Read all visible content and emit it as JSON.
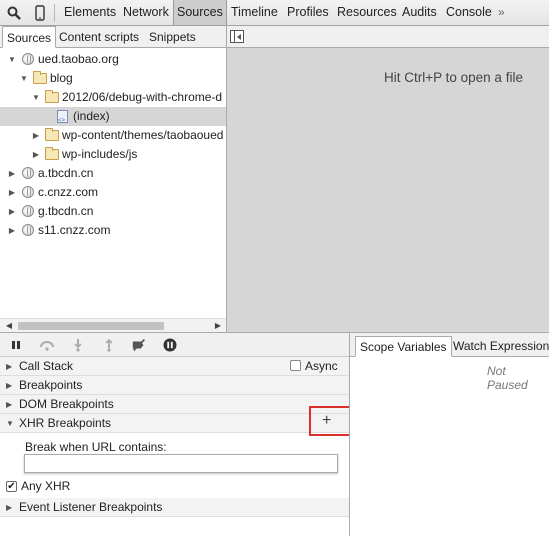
{
  "toolbar": {
    "search_icon": "search-icon",
    "device_icon": "mobile-device-icon",
    "tabs": [
      "Elements",
      "Network",
      "Sources",
      "Timeline",
      "Profiles",
      "Resources",
      "Audits",
      "Console"
    ],
    "active_tab": "Sources",
    "more_glyph": "»"
  },
  "navigator": {
    "tabs": [
      "Sources",
      "Content scripts",
      "Snippets"
    ],
    "active_tab": "Sources",
    "tree": [
      {
        "label": "ued.taobao.org",
        "type": "domain",
        "expanded": true
      },
      {
        "label": "blog",
        "type": "folder",
        "expanded": true
      },
      {
        "label": "2012/06/debug-with-chrome-d",
        "type": "folder",
        "expanded": true
      },
      {
        "label": "(index)",
        "type": "file",
        "selected": true
      },
      {
        "label": "wp-content/themes/taobaoued",
        "type": "folder",
        "expanded": false
      },
      {
        "label": "wp-includes/js",
        "type": "folder",
        "expanded": false
      },
      {
        "label": "a.tbcdn.cn",
        "type": "domain",
        "expanded": false
      },
      {
        "label": "c.cnzz.com",
        "type": "domain",
        "expanded": false
      },
      {
        "label": "g.tbcdn.cn",
        "type": "domain",
        "expanded": false
      },
      {
        "label": "s11.cnzz.com",
        "type": "domain",
        "expanded": false
      }
    ]
  },
  "editor": {
    "hint": "Hit Ctrl+P to open a file"
  },
  "debugger": {
    "buttons": [
      "pause-icon",
      "step-over-icon",
      "step-into-icon",
      "step-out-icon",
      "deactivate-breakpoints-icon",
      "pause-on-exceptions-icon"
    ],
    "panes": {
      "call_stack": "Call Stack",
      "async_label": "Async",
      "breakpoints": "Breakpoints",
      "dom_breakpoints": "DOM Breakpoints",
      "xhr_breakpoints": "XHR Breakpoints",
      "event_listener_breakpoints": "Event Listener Breakpoints"
    },
    "xhr": {
      "add_glyph": "+",
      "url_label": "Break when URL contains:",
      "url_value": "",
      "any_xhr_label": "Any XHR",
      "any_xhr_checked": true
    },
    "highlight_color": "#d9302c"
  },
  "sidebar": {
    "tabs": [
      "Scope Variables",
      "Watch Expressions"
    ],
    "active_tab": "Scope Variables",
    "status": "Not Paused"
  }
}
